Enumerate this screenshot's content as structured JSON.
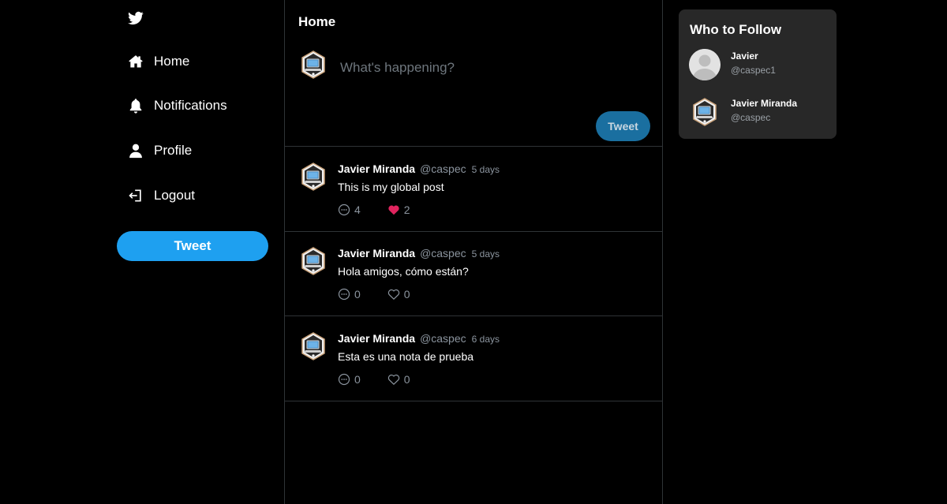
{
  "colors": {
    "background": "#000000",
    "accent": "#1ea0f0",
    "accent_disabled": "#1a6fa0",
    "like_active": "#e0245e",
    "panel": "#282828",
    "border": "#2f3336"
  },
  "sidebar": {
    "logo_icon": "twitter-bird-icon",
    "items": [
      {
        "label": "Home",
        "icon": "home-icon"
      },
      {
        "label": "Notifications",
        "icon": "bell-icon"
      },
      {
        "label": "Profile",
        "icon": "user-icon"
      },
      {
        "label": "Logout",
        "icon": "logout-icon"
      }
    ],
    "tweet_button": "Tweet"
  },
  "main": {
    "title": "Home",
    "composer": {
      "placeholder": "What's happening?",
      "value": "",
      "tweet_button": "Tweet"
    },
    "tweets": [
      {
        "name": "Javier Miranda",
        "handle": "@caspec",
        "time": "5 days",
        "text": "This is my global post",
        "replies": "4",
        "likes": "2",
        "liked": true
      },
      {
        "name": "Javier Miranda",
        "handle": "@caspec",
        "time": "5 days",
        "text": "Hola amigos, cómo están?",
        "replies": "0",
        "likes": "0",
        "liked": false
      },
      {
        "name": "Javier Miranda",
        "handle": "@caspec",
        "time": "6 days",
        "text": "Esta es una nota de prueba",
        "replies": "0",
        "likes": "0",
        "liked": false
      }
    ]
  },
  "who_to_follow": {
    "title": "Who to Follow",
    "users": [
      {
        "name": "Javier",
        "handle": "@caspec1",
        "avatar": "default-avatar"
      },
      {
        "name": "Javier Miranda",
        "handle": "@caspec",
        "avatar": "laptop-hexagon-avatar"
      }
    ]
  }
}
